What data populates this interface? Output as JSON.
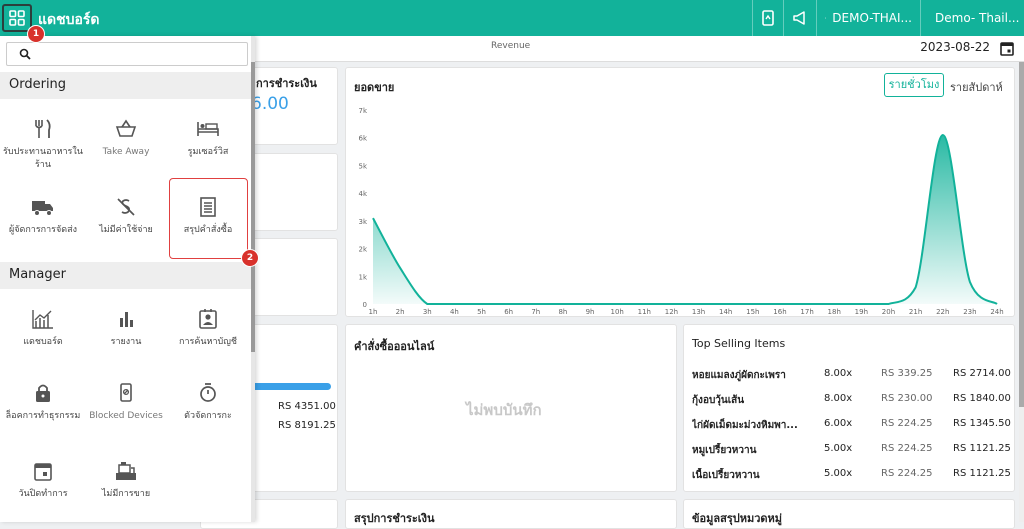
{
  "topbar": {
    "title": "แดชบอร์ด",
    "store": "DEMO-THAI...",
    "user": "Demo- Thail..."
  },
  "subbar": {
    "tab": "Revenue",
    "date": "2023-08-22"
  },
  "search": {
    "placeholder": ""
  },
  "drawer": {
    "sections": [
      {
        "label": "Ordering",
        "items": [
          {
            "label": "รับประทานอาหารในร้าน",
            "icon": "fork-knife-icon"
          },
          {
            "label": "Take Away",
            "icon": "basket-icon"
          },
          {
            "label": "รูมเซอร์วิส",
            "icon": "bed-icon"
          },
          {
            "label": "ผู้จัดการการจัดส่ง",
            "icon": "truck-icon"
          },
          {
            "label": "ไม่มีค่าใช้จ่าย",
            "icon": "no-money-icon"
          },
          {
            "label": "สรุปคำสั่งซื้อ",
            "icon": "receipt-icon"
          }
        ]
      },
      {
        "label": "Manager",
        "items": [
          {
            "label": "แดชบอร์ด",
            "icon": "chart-icon"
          },
          {
            "label": "รายงาน",
            "icon": "bar-icon"
          },
          {
            "label": "การค้นหาบัญชี",
            "icon": "account-icon"
          },
          {
            "label": "ล็อคการทำธุรกรรม",
            "icon": "lock-icon"
          },
          {
            "label": "Blocked Devices",
            "icon": "device-icon"
          },
          {
            "label": "ตัวจัดการกะ",
            "icon": "stopwatch-icon"
          },
          {
            "label": "วันปิดทำการ",
            "icon": "calendar-icon"
          },
          {
            "label": "ไม่มีการขาย",
            "icon": "register-icon"
          }
        ]
      }
    ]
  },
  "badges": [
    "1",
    "2"
  ],
  "cards": {
    "payment_partial_title": "การชำระเงิน",
    "payment_partial_value": "6.00",
    "amount1": "RS 4351.00",
    "amount2": "RS 8191.25",
    "sales_title": "ยอดขาย",
    "toggle_hourly": "รายชั่วโมง",
    "toggle_weekly": "รายสัปดาห์",
    "online_title": "คำสั่งซื้อออนไลน์",
    "online_empty": "ไม่พบบันทึก",
    "top_title": "Top Selling Items",
    "payment_summary_title": "สรุปการชำระเงิน",
    "category_summary_title": "ข้อมูลสรุปหมวดหมู่"
  },
  "top_selling": [
    {
      "name": "หอยแมลงภู่ผัดกะเพรา",
      "qty": "8.00x",
      "price": "RS 339.25",
      "total": "RS 2714.00"
    },
    {
      "name": "กุ้งอบวุ้นเส้น",
      "qty": "8.00x",
      "price": "RS 230.00",
      "total": "RS 1840.00"
    },
    {
      "name": "ไก่ผัดเม็ดมะม่วงหิมพา...",
      "qty": "6.00x",
      "price": "RS 224.25",
      "total": "RS 1345.50"
    },
    {
      "name": "หมูเปรี้ยวหวาน",
      "qty": "5.00x",
      "price": "RS 224.25",
      "total": "RS 1121.25"
    },
    {
      "name": "เนื้อเปรี้ยวหวาน",
      "qty": "5.00x",
      "price": "RS 224.25",
      "total": "RS 1121.25"
    }
  ],
  "chart_data": {
    "type": "area",
    "title": "ยอดขาย",
    "categories": [
      "1h",
      "2h",
      "3h",
      "4h",
      "5h",
      "6h",
      "7h",
      "8h",
      "9h",
      "10h",
      "11h",
      "12h",
      "13h",
      "14h",
      "15h",
      "16h",
      "17h",
      "18h",
      "19h",
      "20h",
      "21h",
      "22h",
      "23h",
      "24h"
    ],
    "values": [
      3100,
      1300,
      0,
      0,
      0,
      0,
      0,
      0,
      0,
      0,
      0,
      0,
      0,
      0,
      0,
      0,
      0,
      0,
      0,
      0,
      600,
      6100,
      800,
      0
    ],
    "yticks": [
      "0",
      "1k",
      "2k",
      "3k",
      "4k",
      "5k",
      "6k",
      "7k"
    ],
    "ylim": [
      0,
      7000
    ],
    "color": "#12b29a"
  },
  "colors": {
    "brand": "#12b29a",
    "badge": "#d8312b"
  }
}
